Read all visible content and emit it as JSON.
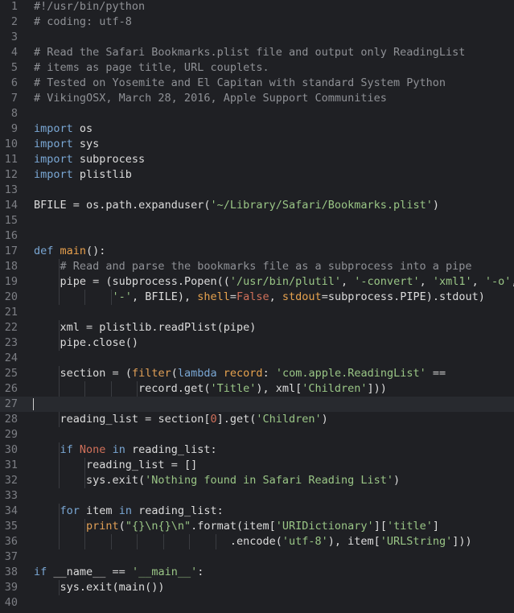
{
  "editor": {
    "theme": {
      "background": "#1f2024",
      "comment": "#8f9196",
      "keyword": "#7aa7d4",
      "function": "#e8a04c",
      "string": "#9ac686",
      "builtin": "#e09f56",
      "constant": "#d0705a",
      "text": "#dcdcdc",
      "line_number": "#7d7f85"
    },
    "current_line": 27,
    "lines": [
      {
        "n": "1",
        "indent": 0,
        "tokens": [
          [
            "cm",
            "#!/usr/bin/python"
          ]
        ]
      },
      {
        "n": "2",
        "indent": 0,
        "tokens": [
          [
            "cm",
            "# coding: utf-8"
          ]
        ]
      },
      {
        "n": "3",
        "indent": 0,
        "tokens": []
      },
      {
        "n": "4",
        "indent": 0,
        "tokens": [
          [
            "cm",
            "# Read the Safari Bookmarks.plist file and output only ReadingList"
          ]
        ]
      },
      {
        "n": "5",
        "indent": 0,
        "tokens": [
          [
            "cm",
            "# items as page title, URL couplets."
          ]
        ]
      },
      {
        "n": "6",
        "indent": 0,
        "tokens": [
          [
            "cm",
            "# Tested on Yosemite and El Capitan with standard System Python"
          ]
        ]
      },
      {
        "n": "7",
        "indent": 0,
        "tokens": [
          [
            "cm",
            "# VikingOSX, March 28, 2016, Apple Support Communities"
          ]
        ]
      },
      {
        "n": "8",
        "indent": 0,
        "tokens": []
      },
      {
        "n": "9",
        "indent": 0,
        "tokens": [
          [
            "kw",
            "import"
          ],
          [
            "tx",
            " os"
          ]
        ]
      },
      {
        "n": "10",
        "indent": 0,
        "tokens": [
          [
            "kw",
            "import"
          ],
          [
            "tx",
            " sys"
          ]
        ]
      },
      {
        "n": "11",
        "indent": 0,
        "tokens": [
          [
            "kw",
            "import"
          ],
          [
            "tx",
            " subprocess"
          ]
        ]
      },
      {
        "n": "12",
        "indent": 0,
        "tokens": [
          [
            "kw",
            "import"
          ],
          [
            "tx",
            " plistlib"
          ]
        ]
      },
      {
        "n": "13",
        "indent": 0,
        "tokens": []
      },
      {
        "n": "14",
        "indent": 0,
        "tokens": [
          [
            "tx",
            "BFILE "
          ],
          [
            "op",
            "="
          ],
          [
            "tx",
            " os.path.expanduser("
          ],
          [
            "st",
            "'~/Library/Safari/Bookmarks.plist'"
          ],
          [
            "tx",
            ")"
          ]
        ]
      },
      {
        "n": "15",
        "indent": 0,
        "tokens": []
      },
      {
        "n": "16",
        "indent": 0,
        "tokens": []
      },
      {
        "n": "17",
        "indent": 0,
        "tokens": [
          [
            "kw",
            "def"
          ],
          [
            "tx",
            " "
          ],
          [
            "fn",
            "main"
          ],
          [
            "tx",
            "():"
          ]
        ]
      },
      {
        "n": "18",
        "indent": 1,
        "tokens": [
          [
            "tx",
            "    "
          ],
          [
            "cm",
            "# Read and parse the bookmarks file as a subprocess into a pipe"
          ]
        ]
      },
      {
        "n": "19",
        "indent": 1,
        "tokens": [
          [
            "tx",
            "    pipe "
          ],
          [
            "op",
            "="
          ],
          [
            "tx",
            " (subprocess.Popen(("
          ],
          [
            "st",
            "'/usr/bin/plutil'"
          ],
          [
            "tx",
            ", "
          ],
          [
            "st",
            "'-convert'"
          ],
          [
            "tx",
            ", "
          ],
          [
            "st",
            "'xml1'"
          ],
          [
            "tx",
            ", "
          ],
          [
            "st",
            "'-o'"
          ],
          [
            "tx",
            ","
          ]
        ]
      },
      {
        "n": "20",
        "indent": 3,
        "tokens": [
          [
            "tx",
            "            "
          ],
          [
            "st",
            "'-'"
          ],
          [
            "tx",
            ", BFILE), "
          ],
          [
            "pm",
            "shell"
          ],
          [
            "op",
            "="
          ],
          [
            "co",
            "False"
          ],
          [
            "tx",
            ", "
          ],
          [
            "pm",
            "stdout"
          ],
          [
            "op",
            "="
          ],
          [
            "tx",
            "subprocess.PIPE).stdout)"
          ]
        ]
      },
      {
        "n": "21",
        "indent": 0,
        "tokens": []
      },
      {
        "n": "22",
        "indent": 1,
        "tokens": [
          [
            "tx",
            "    xml "
          ],
          [
            "op",
            "="
          ],
          [
            "tx",
            " plistlib.readPlist(pipe)"
          ]
        ]
      },
      {
        "n": "23",
        "indent": 1,
        "tokens": [
          [
            "tx",
            "    pipe.close()"
          ]
        ]
      },
      {
        "n": "24",
        "indent": 0,
        "tokens": []
      },
      {
        "n": "25",
        "indent": 1,
        "tokens": [
          [
            "tx",
            "    section "
          ],
          [
            "op",
            "="
          ],
          [
            "tx",
            " ("
          ],
          [
            "bi",
            "filter"
          ],
          [
            "tx",
            "("
          ],
          [
            "kw",
            "lambda"
          ],
          [
            "tx",
            " "
          ],
          [
            "pm",
            "record"
          ],
          [
            "tx",
            ": "
          ],
          [
            "st",
            "'com.apple.ReadingList'"
          ],
          [
            "tx",
            " "
          ],
          [
            "op",
            "=="
          ]
        ]
      },
      {
        "n": "26",
        "indent": 4,
        "tokens": [
          [
            "tx",
            "                record.get("
          ],
          [
            "st",
            "'Title'"
          ],
          [
            "tx",
            "), xml["
          ],
          [
            "st",
            "'Children'"
          ],
          [
            "tx",
            "]))"
          ]
        ]
      },
      {
        "n": "27",
        "indent": 0,
        "tokens": []
      },
      {
        "n": "28",
        "indent": 1,
        "tokens": [
          [
            "tx",
            "    reading_list "
          ],
          [
            "op",
            "="
          ],
          [
            "tx",
            " section["
          ],
          [
            "co",
            "0"
          ],
          [
            "tx",
            "].get("
          ],
          [
            "st",
            "'Children'"
          ],
          [
            "tx",
            ")"
          ]
        ]
      },
      {
        "n": "29",
        "indent": 0,
        "tokens": []
      },
      {
        "n": "30",
        "indent": 1,
        "tokens": [
          [
            "tx",
            "    "
          ],
          [
            "kw",
            "if"
          ],
          [
            "tx",
            " "
          ],
          [
            "co",
            "None"
          ],
          [
            "tx",
            " "
          ],
          [
            "kw",
            "in"
          ],
          [
            "tx",
            " reading_list:"
          ]
        ]
      },
      {
        "n": "31",
        "indent": 2,
        "tokens": [
          [
            "tx",
            "        reading_list "
          ],
          [
            "op",
            "="
          ],
          [
            "tx",
            " []"
          ]
        ]
      },
      {
        "n": "32",
        "indent": 2,
        "tokens": [
          [
            "tx",
            "        sys.exit("
          ],
          [
            "st",
            "'Nothing found in Safari Reading List'"
          ],
          [
            "tx",
            ")"
          ]
        ]
      },
      {
        "n": "33",
        "indent": 0,
        "tokens": []
      },
      {
        "n": "34",
        "indent": 1,
        "tokens": [
          [
            "tx",
            "    "
          ],
          [
            "kw",
            "for"
          ],
          [
            "tx",
            " item "
          ],
          [
            "kw",
            "in"
          ],
          [
            "tx",
            " reading_list:"
          ]
        ]
      },
      {
        "n": "35",
        "indent": 2,
        "tokens": [
          [
            "tx",
            "        "
          ],
          [
            "bi",
            "print"
          ],
          [
            "tx",
            "("
          ],
          [
            "st",
            "\"{}\\n{}\\n\""
          ],
          [
            "tx",
            ".format(item["
          ],
          [
            "st",
            "'URIDictionary'"
          ],
          [
            "tx",
            "]["
          ],
          [
            "st",
            "'title'"
          ],
          [
            "tx",
            "]"
          ]
        ]
      },
      {
        "n": "36",
        "indent": 7,
        "tokens": [
          [
            "tx",
            "                              .encode("
          ],
          [
            "st",
            "'utf-8'"
          ],
          [
            "tx",
            "), item["
          ],
          [
            "st",
            "'URLString'"
          ],
          [
            "tx",
            "]))"
          ]
        ]
      },
      {
        "n": "37",
        "indent": 0,
        "tokens": []
      },
      {
        "n": "38",
        "indent": 0,
        "tokens": [
          [
            "kw",
            "if"
          ],
          [
            "tx",
            " __name__ "
          ],
          [
            "op",
            "=="
          ],
          [
            "tx",
            " "
          ],
          [
            "st",
            "'__main__'"
          ],
          [
            "tx",
            ":"
          ]
        ]
      },
      {
        "n": "39",
        "indent": 1,
        "tokens": [
          [
            "tx",
            "    sys.exit(main())"
          ]
        ]
      },
      {
        "n": "40",
        "indent": 0,
        "tokens": []
      }
    ]
  }
}
